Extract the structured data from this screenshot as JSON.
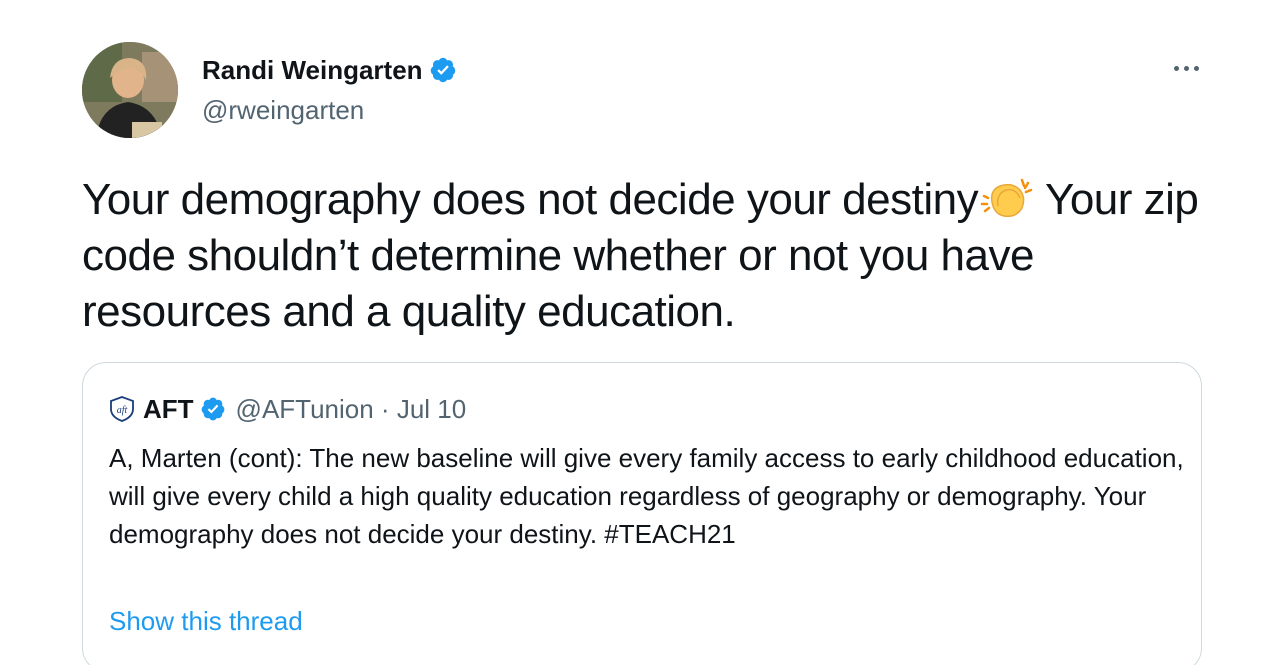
{
  "author": {
    "name": "Randi Weingarten",
    "handle": "@rweingarten",
    "verified_color": "#1d9bf0"
  },
  "tweet": {
    "text_part1": "Your demography does not decide your destiny",
    "emoji": "clapping-hands",
    "text_part2": " Your zip code shouldn’t determine whether or not you have resources and a quality education."
  },
  "quoted": {
    "name": "AFT",
    "handle": "@AFTunion",
    "separator": " · ",
    "date": "Jul 10",
    "text": "A, Marten (cont): The new baseline will give every family access to early childhood education, will give every child a high quality education regardless of geography or demography. Your demography does not decide your destiny. #TEACH21",
    "show_thread": "Show this thread"
  },
  "colors": {
    "accent": "#1d9bf0",
    "secondary_text": "#536471",
    "border": "#cfd9de"
  }
}
